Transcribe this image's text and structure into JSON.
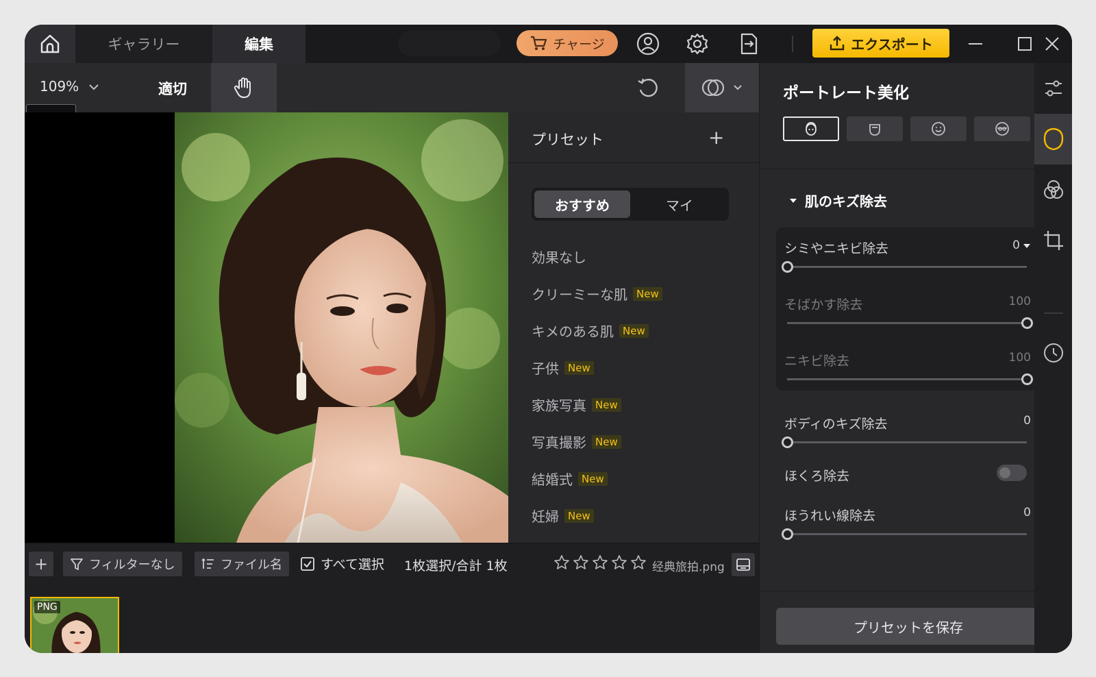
{
  "titlebar": {
    "home_tooltip": "ホーム",
    "tabs": [
      {
        "label": "ギャラリー"
      },
      {
        "label": "編集"
      }
    ],
    "charge_label": "チャージ",
    "export_label": "エクスポート"
  },
  "toolbar": {
    "zoom": "109%",
    "fit_label": "適切"
  },
  "preset_panel": {
    "title": "プリセット",
    "add_label": "+",
    "segments": [
      "おすすめ",
      "マイ"
    ],
    "items": [
      {
        "label": "効果なし",
        "badge": ""
      },
      {
        "label": "クリーミーな肌",
        "badge": "New"
      },
      {
        "label": "キメのある肌",
        "badge": "New"
      },
      {
        "label": "子供",
        "badge": "New"
      },
      {
        "label": "家族写真",
        "badge": "New"
      },
      {
        "label": "写真撮影",
        "badge": "New"
      },
      {
        "label": "結婚式",
        "badge": "New"
      },
      {
        "label": "妊婦",
        "badge": "New"
      }
    ]
  },
  "bottom_bar": {
    "add_label": "+",
    "filter_label": "フィルターなし",
    "sort_label": "ファイル名",
    "select_all_label": "すべて選択",
    "selection_count": "1枚選択/合計 1枚",
    "rating": 0,
    "rating_max": 5,
    "file_name": "经典旅拍.png",
    "thumb_format": "PNG"
  },
  "right_panel": {
    "title": "ポートレート美化",
    "face_tabs": [
      "face-detail-icon",
      "face-shape-icon",
      "face-smile-icon",
      "face-glasses-icon"
    ],
    "section_title": "肌のキズ除去",
    "sliders_group": [
      {
        "label": "シミやニキビ除去",
        "value": "0",
        "fraction": 0.0,
        "dim": false,
        "has_dropdown": true
      },
      {
        "label": "そばかす除去",
        "value": "100",
        "fraction": 1.0,
        "dim": true,
        "has_dropdown": false
      },
      {
        "label": "ニキビ除去",
        "value": "100",
        "fraction": 1.0,
        "dim": true,
        "has_dropdown": false
      }
    ],
    "sliders": [
      {
        "label": "ボディのキズ除去",
        "value": "0",
        "fraction": 0.0
      },
      {
        "label": "ほうれい線除去",
        "value": "0",
        "fraction": 0.0
      }
    ],
    "mole_label": "ほくろ除去",
    "mole_toggle": false,
    "save_preset_label": "プリセットを保存"
  },
  "colors": {
    "accent_yellow": "#f5b800",
    "charge_orange": "#eda063",
    "panel_bg": "#28282b"
  }
}
